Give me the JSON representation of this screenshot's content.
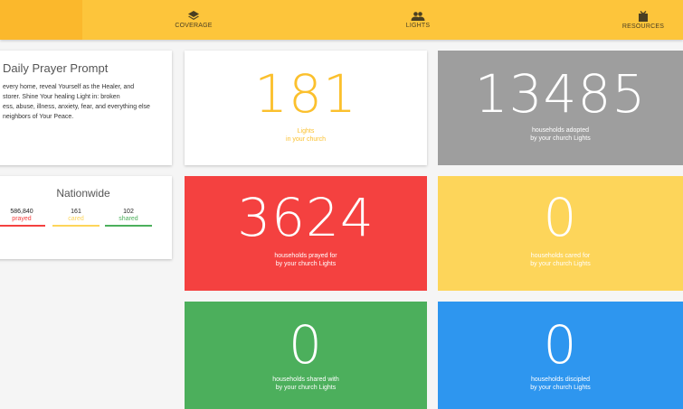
{
  "nav": {
    "items": [
      {
        "label": "COVERAGE",
        "icon": "layers-icon"
      },
      {
        "label": "LIGHTS",
        "icon": "people-icon"
      },
      {
        "label": "RESOURCES",
        "icon": "resources-icon"
      }
    ]
  },
  "prompt": {
    "title": "Daily Prayer Prompt",
    "line1": "every home, reveal Yourself as the Healer, and",
    "line2": "storer. Shine Your healing Light in: broken",
    "line3": "ess, abuse, illness, anxiety, fear, and everything else",
    "line4": "neighbors of Your Peace."
  },
  "nationwide": {
    "title": "Nationwide",
    "stats": [
      {
        "value": "586,840",
        "label": "prayed",
        "color": "#f44140"
      },
      {
        "value": "161",
        "label": "cared",
        "color": "#fdd55a"
      },
      {
        "value": "102",
        "label": "shared",
        "color": "#4caf5c"
      }
    ]
  },
  "tiles": {
    "lights": {
      "value": "181",
      "line1": "Lights",
      "line2": "in your church",
      "color": "#fbc02d"
    },
    "adopted": {
      "value": "13485",
      "line1": "households adopted",
      "line2": "by your church Lights"
    },
    "prayed": {
      "value": "3624",
      "line1": "households prayed for",
      "line2": "by your church Lights"
    },
    "cared": {
      "value": "0",
      "line1": "households cared for",
      "line2": "by your church Lights"
    },
    "shared": {
      "value": "0",
      "line1": "households shared with",
      "line2": "by your church Lights"
    },
    "discipled": {
      "value": "0",
      "line1": "households discipled",
      "line2": "by your church Lights"
    }
  }
}
